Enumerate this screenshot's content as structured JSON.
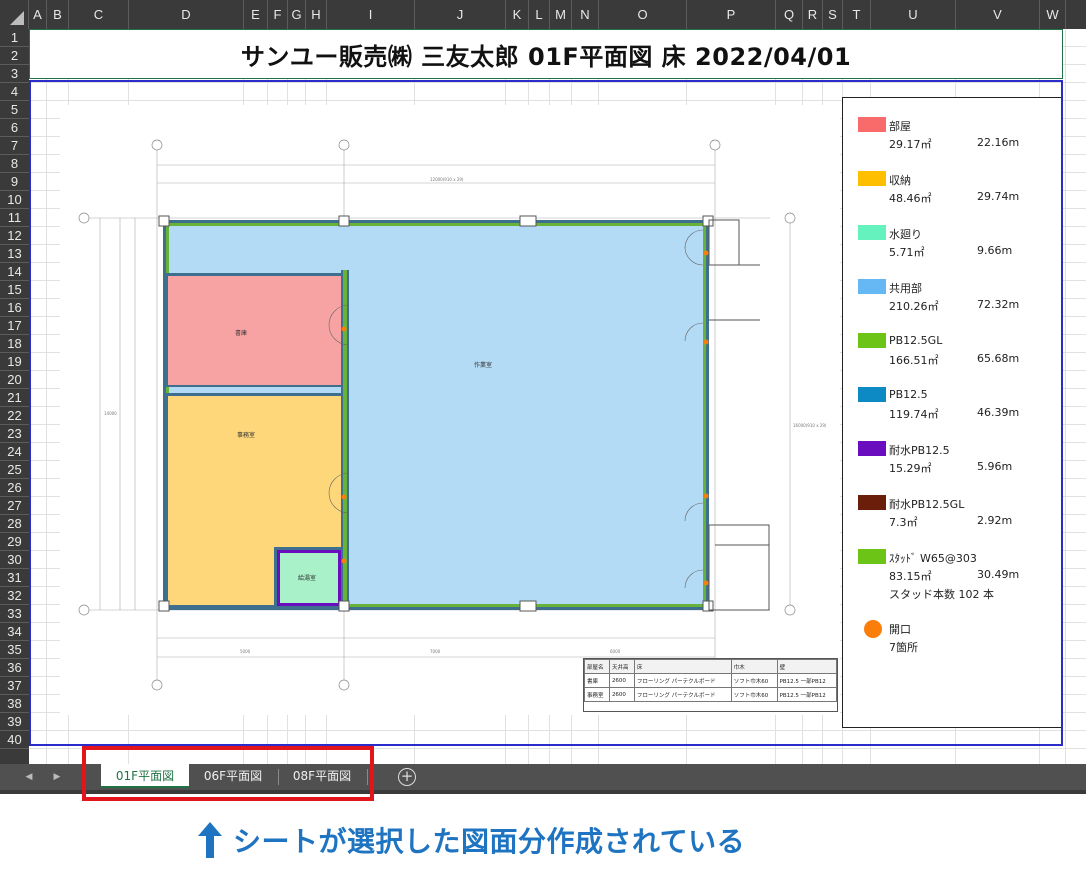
{
  "spreadsheet": {
    "columns": [
      "A",
      "B",
      "C",
      "D",
      "E",
      "F",
      "G",
      "H",
      "I",
      "J",
      "K",
      "L",
      "M",
      "N",
      "O",
      "P",
      "Q",
      "R",
      "S",
      "T",
      "U",
      "V",
      "W"
    ],
    "rows": [
      "1",
      "2",
      "3",
      "4",
      "5",
      "6",
      "7",
      "8",
      "9",
      "10",
      "11",
      "12",
      "13",
      "14",
      "15",
      "16",
      "17",
      "18",
      "19",
      "20",
      "21",
      "22",
      "23",
      "24",
      "25",
      "26",
      "27",
      "28",
      "29",
      "30",
      "31",
      "32",
      "33",
      "34",
      "35",
      "36",
      "37",
      "38",
      "39",
      "40"
    ],
    "title": "サンユー販売㈱ 三友太郎 01F平面図 床 2022/04/01"
  },
  "floorplan": {
    "rooms": [
      {
        "name": "書庫",
        "color": "#f7a3a3"
      },
      {
        "name": "事務室",
        "color": "#fdd77a"
      },
      {
        "name": "給湯室",
        "color": "#a9f2c9"
      },
      {
        "name": "作業室",
        "color": "#b3dbf6"
      }
    ],
    "finish_table": {
      "headers": [
        "部屋名",
        "天井高",
        "床",
        "巾木",
        "壁"
      ],
      "rows": [
        [
          "書庫",
          "2600",
          "フローリング パーテクルボード",
          "ソフト巾木60",
          "PB12.5 一部PB12"
        ],
        [
          "事務室",
          "2600",
          "フローリング パーテクルボード",
          "ソフト巾木60",
          "PB12.5 一部PB12"
        ]
      ]
    }
  },
  "legend": {
    "items": [
      {
        "name": "部屋",
        "area": "29.17㎡",
        "length": "22.16m",
        "color": "#f96b6b"
      },
      {
        "name": "収納",
        "area": "48.46㎡",
        "length": "29.74m",
        "color": "#fdbf00"
      },
      {
        "name": "水廻り",
        "area": "5.71㎡",
        "length": "9.66m",
        "color": "#66f2bf"
      },
      {
        "name": "共用部",
        "area": "210.26㎡",
        "length": "72.32m",
        "color": "#66b8f5"
      },
      {
        "name": "PB12.5GL",
        "area": "166.51㎡",
        "length": "65.68m",
        "color": "#6cc417"
      },
      {
        "name": "PB12.5",
        "area": "119.74㎡",
        "length": "46.39m",
        "color": "#0d8ac4"
      },
      {
        "name": "耐水PB12.5",
        "area": "15.29㎡",
        "length": "5.96m",
        "color": "#6a0dbf"
      },
      {
        "name": "耐水PB12.5GL",
        "area": "7.3㎡",
        "length": "2.92m",
        "color": "#6b1e0a"
      },
      {
        "name": "ｽﾀｯﾄﾞ W65@303",
        "area": "83.15㎡",
        "length": "30.49m",
        "color": "#6cc417"
      }
    ],
    "stud_count": "スタッド本数 102 本",
    "opening": {
      "name": "開口",
      "count": "7箇所",
      "color": "#fb7d0a"
    }
  },
  "tabbar": {
    "prev_icon": "◀",
    "next_icon": "▶",
    "tabs": [
      "01F平面図",
      "06F平面図",
      "08F平面図"
    ],
    "active_index": 0,
    "add_icon": "+"
  },
  "caption": {
    "text": "シートが選択した図面分作成されている",
    "color": "#1f74c2"
  }
}
